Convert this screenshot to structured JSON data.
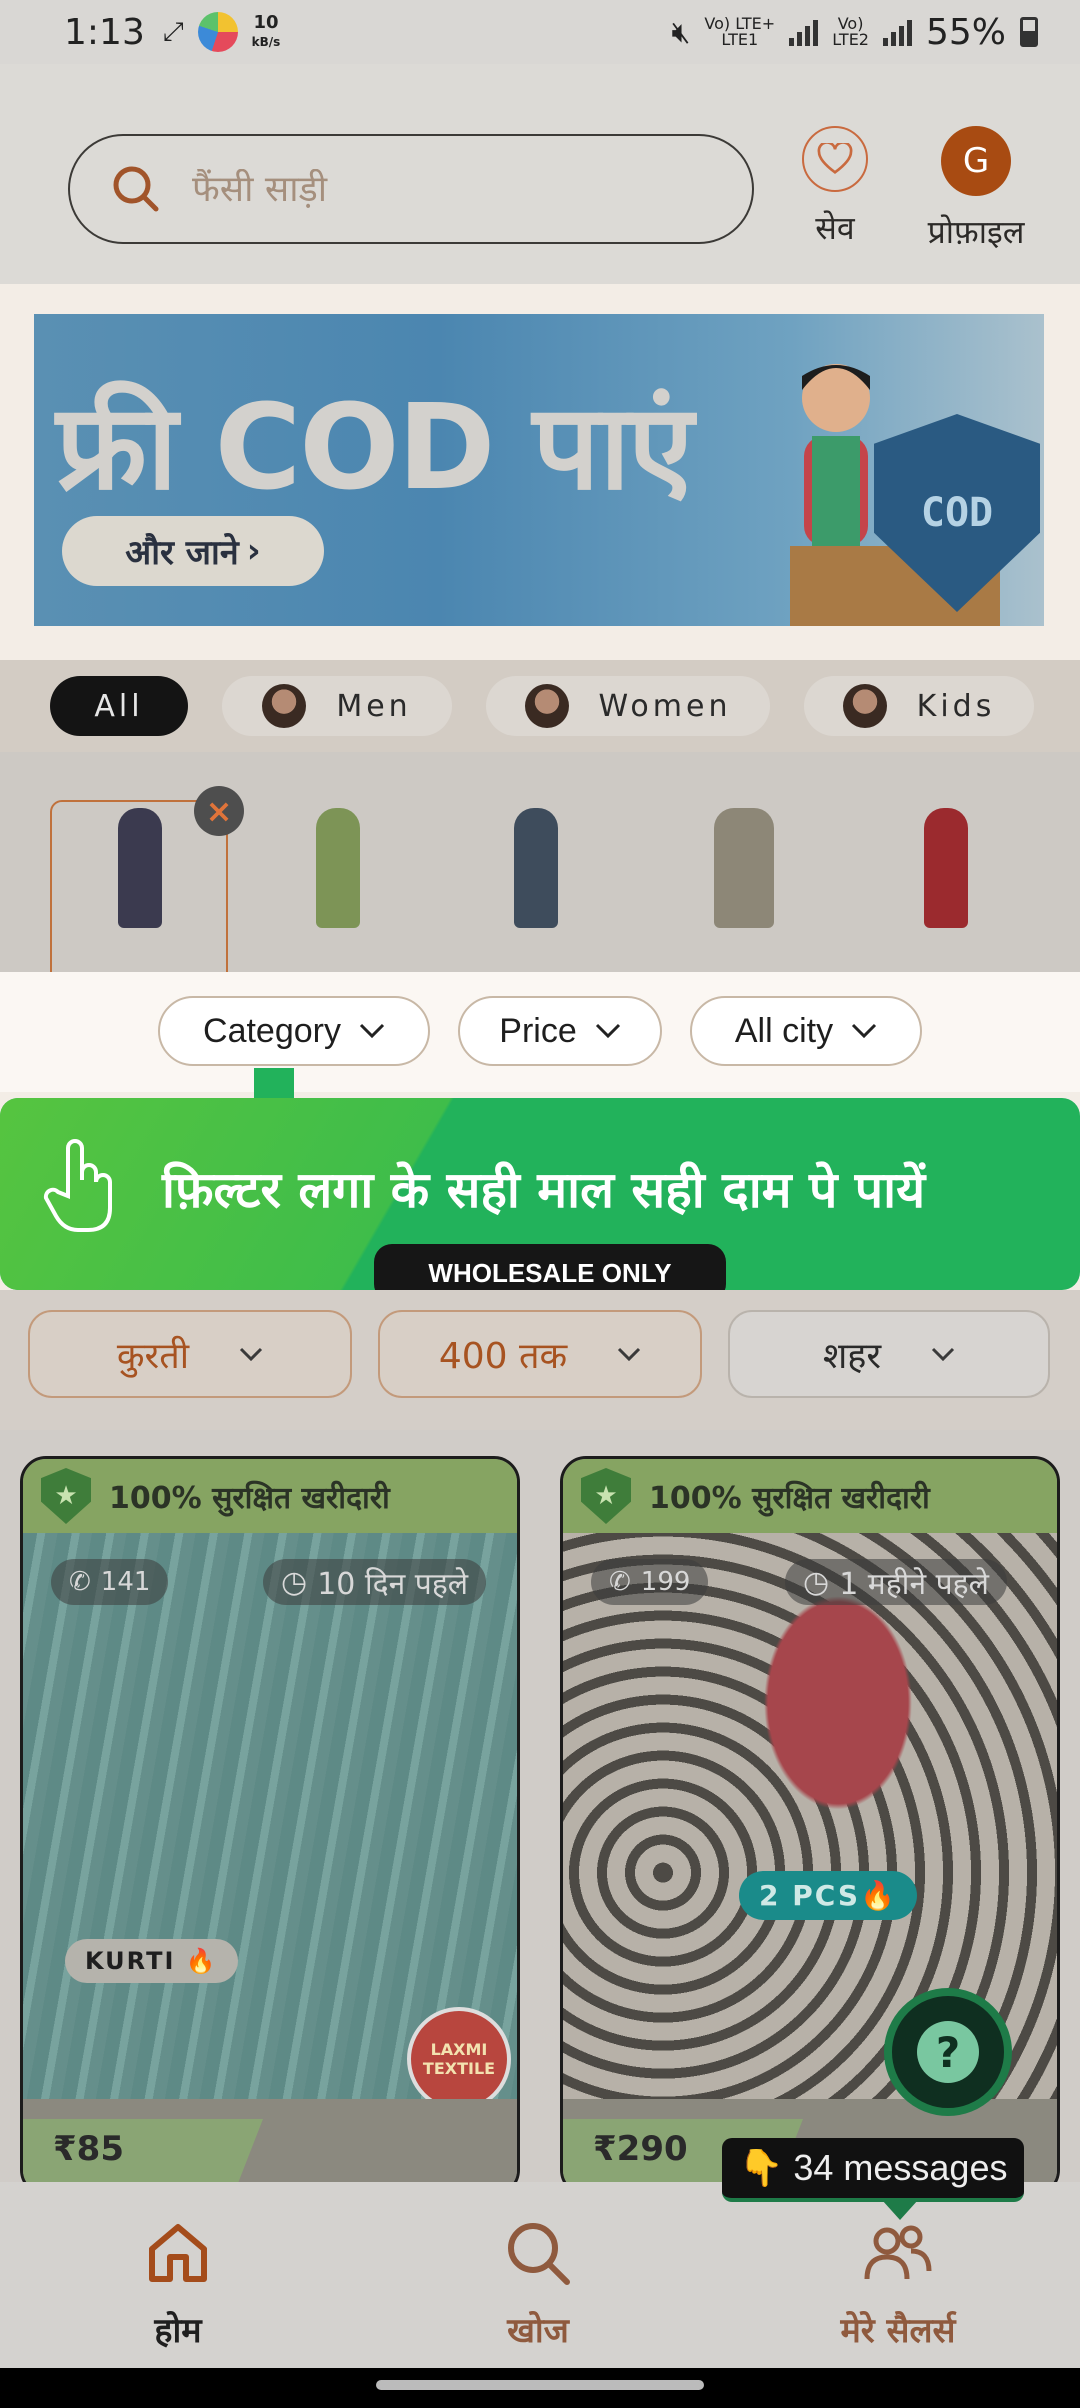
{
  "status_bar": {
    "time": "1:13",
    "speed_value": "10",
    "speed_unit": "kB/s",
    "sim1": "Vo) LTE+",
    "sim1_sub": "LTE1",
    "sim2": "Vo)",
    "sim2_sub": "LTE2",
    "battery": "55%"
  },
  "header": {
    "search_placeholder": "फैंसी साड़ी",
    "save_label": "सेव",
    "profile_label": "प्रोफ़ाइल",
    "profile_initial": "G"
  },
  "banner": {
    "title": "फ्री COD पाएं",
    "cta": "और जाने",
    "shield_text": "COD"
  },
  "segments": [
    {
      "label": "All"
    },
    {
      "label": "Men"
    },
    {
      "label": "Women"
    },
    {
      "label": "Kids"
    }
  ],
  "filters": [
    {
      "label": "Category"
    },
    {
      "label": "Price"
    },
    {
      "label": "All city"
    }
  ],
  "tooltip": {
    "text": "फ़िल्टर लगा के सही माल सही दाम पे पायें",
    "badge": "WHOLESALE ONLY"
  },
  "hindi_filters": [
    {
      "label": "कुरती"
    },
    {
      "label": "400 तक"
    },
    {
      "label": "शहर"
    }
  ],
  "products": [
    {
      "secure_label": "100% सुरक्षित खरीदारी",
      "whatsapp_count": "141",
      "time_ago": "10 दिन पहले",
      "tag": "KURTI 🔥",
      "price": "₹85",
      "seller_badge": "LAXMI TEXTILE"
    },
    {
      "secure_label": "100% सुरक्षित खरीदारी",
      "whatsapp_count": "199",
      "time_ago": "1 महीने पहले",
      "tag": "2 PCS🔥",
      "price": "₹290"
    }
  ],
  "messages": {
    "label": "34 messages",
    "emoji": "👇"
  },
  "help": {
    "label": "?"
  },
  "bottom_nav": [
    {
      "label": "होम",
      "icon": "home-icon"
    },
    {
      "label": "खोज",
      "icon": "search-icon"
    },
    {
      "label": "मेरे सैलर्स",
      "icon": "sellers-icon"
    }
  ],
  "colors": {
    "accent": "#c0713c",
    "tooltip_green": "#22b25b",
    "dark": "#141414"
  }
}
